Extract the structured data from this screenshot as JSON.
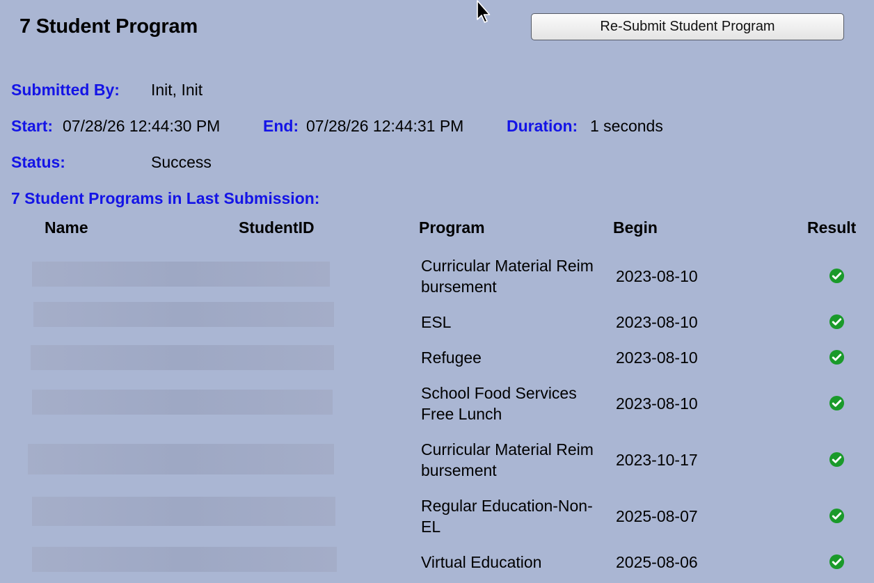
{
  "page": {
    "title": "7 Student Program",
    "resubmit_label": "Re-Submit Student Program"
  },
  "info": {
    "submitted_by_label": "Submitted By:",
    "submitted_by_value": "Init, Init",
    "start_label": "Start:",
    "start_value": "07/28/26 12:44:30 PM",
    "end_label": "End:",
    "end_value": "07/28/26 12:44:31 PM",
    "duration_label": "Duration:",
    "duration_value": "1 seconds",
    "status_label": "Status:",
    "status_value": "Success",
    "section_heading": "7 Student Programs in Last Submission:"
  },
  "table": {
    "headers": [
      "Name",
      "StudentID",
      "Program",
      "Begin",
      "Result"
    ],
    "rows": [
      {
        "program": "Curricular Material Reimbursement",
        "begin": "2023-08-10",
        "result": "check-circle-icon"
      },
      {
        "program": "ESL",
        "begin": "2023-08-10",
        "result": "check-circle-icon"
      },
      {
        "program": "Refugee",
        "begin": "2023-08-10",
        "result": "check-circle-icon"
      },
      {
        "program": "School Food Services Free Lunch",
        "begin": "2023-08-10",
        "result": "check-circle-icon"
      },
      {
        "program": "Curricular Material Reimbursement",
        "begin": "2023-10-17",
        "result": "check-circle-icon"
      },
      {
        "program": "Regular Education-Non-EL",
        "begin": "2025-08-07",
        "result": "check-circle-icon"
      },
      {
        "program": "Virtual Education",
        "begin": "2025-08-06",
        "result": "check-circle-icon"
      }
    ]
  },
  "colors": {
    "background": "#aab6d3",
    "label_blue": "#1414e6",
    "success_green": "#1a9a2a"
  }
}
